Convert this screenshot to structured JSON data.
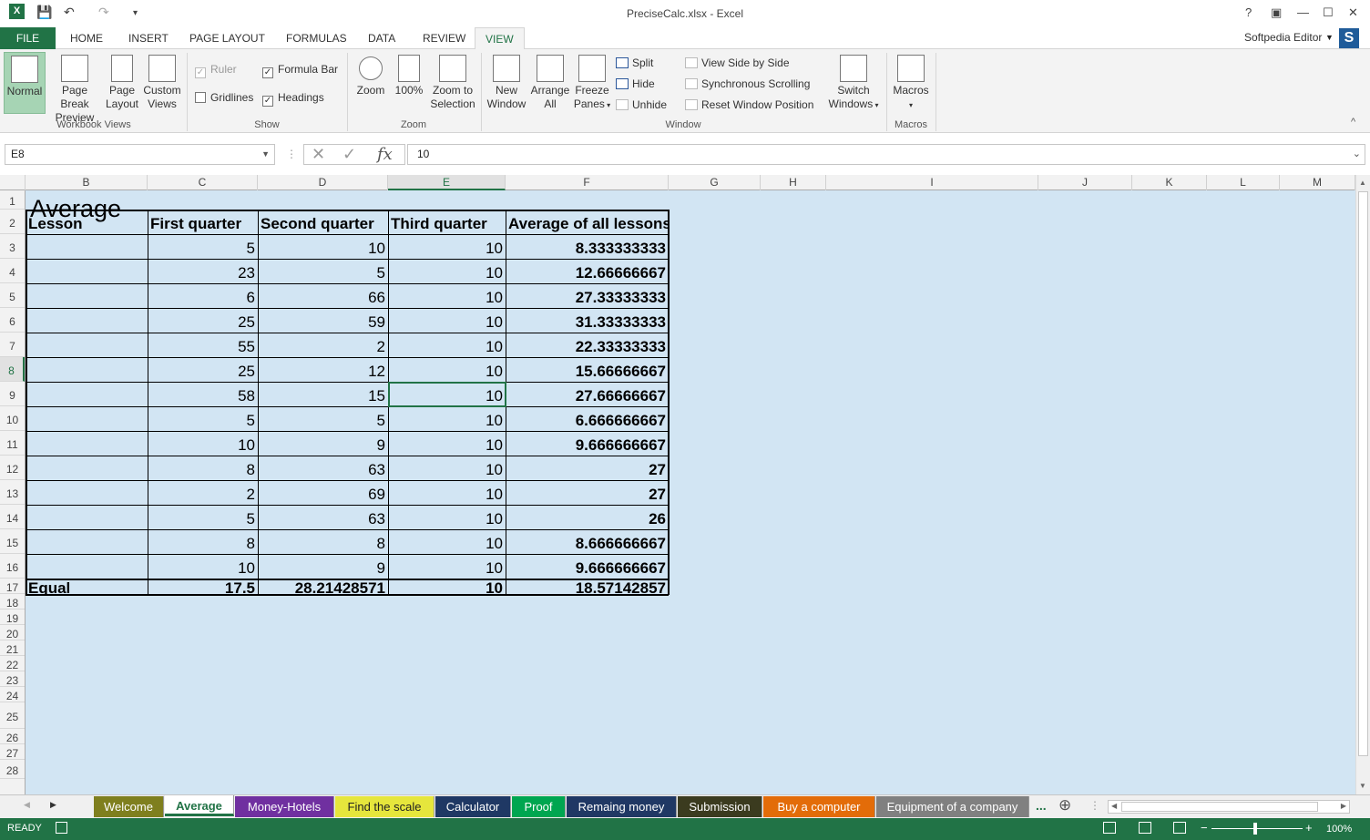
{
  "window": {
    "title": "PreciseCalc.xlsx - Excel",
    "help": "?",
    "minimize": "—",
    "maximize": "☐",
    "close": "✕",
    "restore": "▣"
  },
  "qat": {
    "save": "💾",
    "undo": "↶",
    "redo": "↷",
    "more": "▾"
  },
  "tabs": {
    "file": "FILE",
    "items": [
      "HOME",
      "INSERT",
      "PAGE LAYOUT",
      "FORMULAS",
      "DATA",
      "REVIEW",
      "VIEW"
    ],
    "active": "VIEW"
  },
  "account": {
    "name": "Softpedia Editor",
    "badge": "S"
  },
  "ribbon": {
    "workbook_views": {
      "label": "Workbook Views",
      "normal": "Normal",
      "page_break_1": "Page Break",
      "page_break_2": "Preview",
      "page_layout_1": "Page",
      "page_layout_2": "Layout",
      "custom_views_1": "Custom",
      "custom_views_2": "Views"
    },
    "show": {
      "label": "Show",
      "ruler": "Ruler",
      "formula_bar": "Formula Bar",
      "gridlines": "Gridlines",
      "headings": "Headings"
    },
    "zoom": {
      "label": "Zoom",
      "zoom": "Zoom",
      "hundred": "100%",
      "zoom_sel_1": "Zoom to",
      "zoom_sel_2": "Selection"
    },
    "window": {
      "label": "Window",
      "new_window_1": "New",
      "new_window_2": "Window",
      "arrange_1": "Arrange",
      "arrange_2": "All",
      "freeze_1": "Freeze",
      "freeze_2": "Panes",
      "split": "Split",
      "hide": "Hide",
      "unhide": "Unhide",
      "side_by_side": "View Side by Side",
      "sync_scroll": "Synchronous Scrolling",
      "reset_pos": "Reset Window Position",
      "switch_1": "Switch",
      "switch_2": "Windows"
    },
    "macros": {
      "label": "Macros",
      "macros": "Macros"
    }
  },
  "formula_bar": {
    "name_box": "E8",
    "value": "10",
    "fx": "fx"
  },
  "columns": [
    "B",
    "C",
    "D",
    "E",
    "F",
    "G",
    "H",
    "I",
    "J",
    "K",
    "L",
    "M"
  ],
  "rows": [
    "1",
    "2",
    "3",
    "4",
    "5",
    "6",
    "7",
    "8",
    "9",
    "10",
    "11",
    "12",
    "13",
    "14",
    "15",
    "16",
    "17",
    "18",
    "19",
    "20",
    "21",
    "22",
    "23",
    "24",
    "25",
    "26",
    "27",
    "28"
  ],
  "sheet": {
    "title": "Average",
    "headers": [
      "Lesson",
      "First quarter",
      "Second quarter",
      "Third quarter",
      "Average of all lessons"
    ],
    "data": [
      [
        "",
        "5",
        "10",
        "10",
        "8.333333333"
      ],
      [
        "",
        "23",
        "5",
        "10",
        "12.66666667"
      ],
      [
        "",
        "6",
        "66",
        "10",
        "27.33333333"
      ],
      [
        "",
        "25",
        "59",
        "10",
        "31.33333333"
      ],
      [
        "",
        "55",
        "2",
        "10",
        "22.33333333"
      ],
      [
        "",
        "25",
        "12",
        "10",
        "15.66666667"
      ],
      [
        "",
        "58",
        "15",
        "10",
        "27.66666667"
      ],
      [
        "",
        "5",
        "5",
        "10",
        "6.666666667"
      ],
      [
        "",
        "10",
        "9",
        "10",
        "9.666666667"
      ],
      [
        "",
        "8",
        "63",
        "10",
        "27"
      ],
      [
        "",
        "2",
        "69",
        "10",
        "27"
      ],
      [
        "",
        "5",
        "63",
        "10",
        "26"
      ],
      [
        "",
        "8",
        "8",
        "10",
        "8.666666667"
      ],
      [
        "",
        "10",
        "9",
        "10",
        "9.666666667"
      ]
    ],
    "totals": [
      "Equal",
      "17.5",
      "28.21428571",
      "10",
      "18.57142857"
    ]
  },
  "sheet_tabs": [
    {
      "label": "Welcome",
      "color": "#7f7f1e"
    },
    {
      "label": "Average",
      "color": "#ffffff"
    },
    {
      "label": "Money-Hotels",
      "color": "#7030a0"
    },
    {
      "label": "Find the scale",
      "color": "#e6e63c"
    },
    {
      "label": "Calculator",
      "color": "#1f3864"
    },
    {
      "label": "Proof",
      "color": "#00a650"
    },
    {
      "label": "Remaing money",
      "color": "#203864"
    },
    {
      "label": "Submission",
      "color": "#3b3b1f"
    },
    {
      "label": "Buy a computer",
      "color": "#e36c09"
    },
    {
      "label": "Equipment of a company",
      "color": "#808080"
    }
  ],
  "sheet_tab_more": "...",
  "sheet_tab_add": "⊕",
  "status": {
    "ready": "READY",
    "zoom": "100%"
  }
}
